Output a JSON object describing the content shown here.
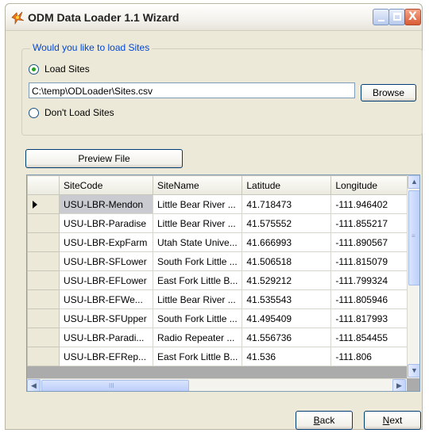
{
  "window": {
    "title": "ODM Data Loader 1.1 Wizard",
    "icons": {
      "app": "odm-app-icon",
      "minimize": "minimize-icon",
      "maximize": "maximize-icon",
      "close": "close-icon"
    },
    "close_glyph": "X"
  },
  "sites_group": {
    "legend": "Would you like to load Sites",
    "load_option": {
      "label": "Load Sites",
      "selected": true
    },
    "dont_load_option": {
      "label": "Don't Load Sites",
      "selected": false
    },
    "file_path": "C:\\temp\\ODLoader\\Sites.csv",
    "browse_label": "Browse"
  },
  "preview_label": "Preview File",
  "table": {
    "columns": [
      "SiteCode",
      "SiteName",
      "Latitude",
      "Longitude"
    ],
    "rows": [
      [
        "USU-LBR-Mendon",
        "Little Bear River ...",
        "41.718473",
        "-111.946402"
      ],
      [
        "USU-LBR-Paradise",
        "Little Bear River ...",
        "41.575552",
        "-111.855217"
      ],
      [
        "USU-LBR-ExpFarm",
        "Utah State Unive...",
        "41.666993",
        "-111.890567"
      ],
      [
        "USU-LBR-SFLower",
        "South Fork Little ...",
        "41.506518",
        "-111.815079"
      ],
      [
        "USU-LBR-EFLower",
        "East Fork Little B...",
        "41.529212",
        "-111.799324"
      ],
      [
        "USU-LBR-EFWe...",
        "Little Bear River ...",
        "41.535543",
        "-111.805946"
      ],
      [
        "USU-LBR-SFUpper",
        "South Fork Little ...",
        "41.495409",
        "-111.817993"
      ],
      [
        "USU-LBR-Paradi...",
        "Radio Repeater ...",
        "41.556736",
        "-111.854455"
      ],
      [
        "USU-LBR-EFRep...",
        "East Fork Little B...",
        "41.536",
        "-111.806"
      ]
    ],
    "current_row_indicator": "current-row-arrow-icon",
    "scroll": {
      "up": "▲",
      "down": "▼",
      "left": "◀",
      "right": "▶",
      "v_grip": "≡",
      "h_grip": "III",
      "icons": {
        "up": "scroll-up-icon",
        "down": "scroll-down-icon",
        "left": "scroll-left-icon",
        "right": "scroll-right-icon"
      }
    }
  },
  "nav": {
    "back_prefix": "",
    "back_access_key": "B",
    "back_rest": "ack",
    "next_prefix": "",
    "next_access_key": "N",
    "next_rest": "ext"
  },
  "colors": {
    "window_bg": "#ece9d8",
    "legend_text": "#0046d5",
    "radio_selected": "#21a121",
    "selected_cell": "#c9cbd1",
    "button_border": "#003c74"
  }
}
